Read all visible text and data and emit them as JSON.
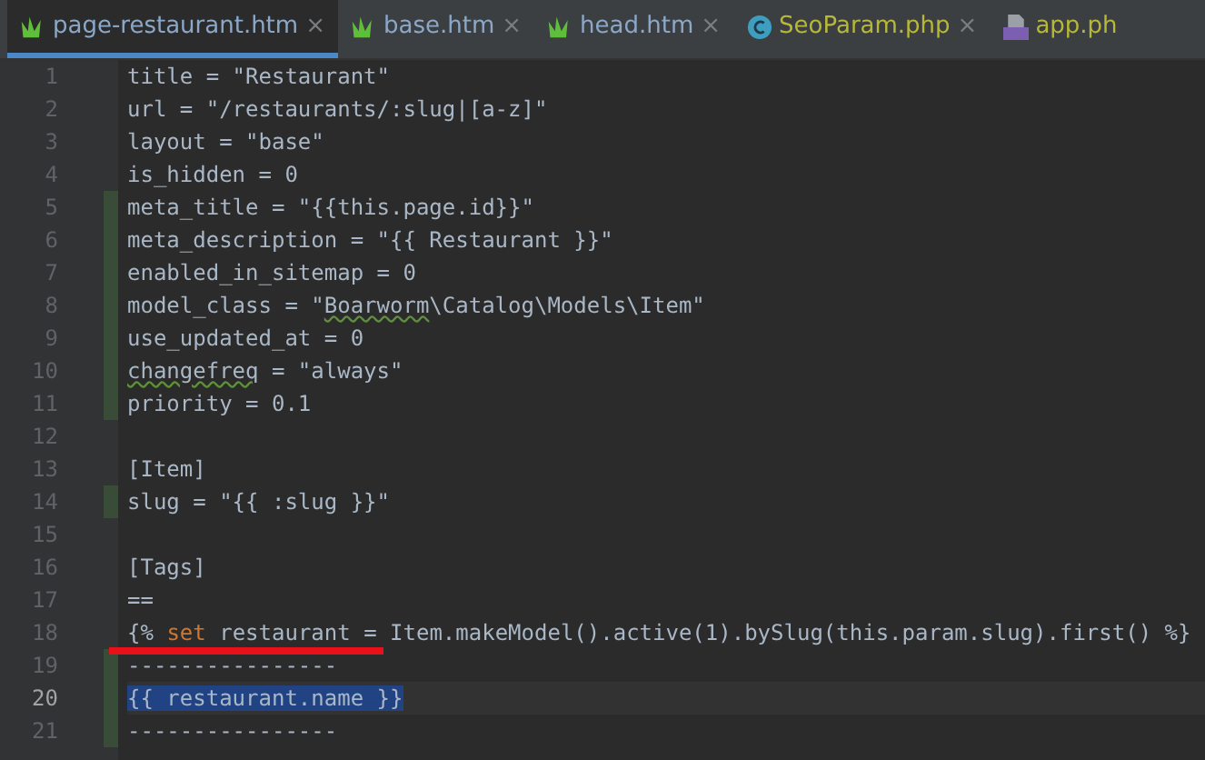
{
  "tabs": [
    {
      "label": "page-restaurant.htm",
      "kind": "htm",
      "color": "#8ca8c8",
      "selected": true,
      "close": "×"
    },
    {
      "label": "base.htm",
      "kind": "htm",
      "color": "#8ca8c8",
      "selected": false,
      "close": "×"
    },
    {
      "label": "head.htm",
      "kind": "htm",
      "color": "#8ca8c8",
      "selected": false,
      "close": "×"
    },
    {
      "label": "SeoParam.php",
      "kind": "class",
      "color": "#b8b838",
      "selected": false,
      "close": "×"
    },
    {
      "label": "app.ph",
      "kind": "php",
      "color": "#b8b838",
      "selected": false
    }
  ],
  "editor": {
    "lines": [
      {
        "number": "1",
        "changed": false,
        "current": false,
        "segments": [
          {
            "text": "title = \"Restaurant\"",
            "kind": "plain"
          }
        ]
      },
      {
        "number": "2",
        "changed": false,
        "current": false,
        "segments": [
          {
            "text": "url = \"/restaurants/:slug|[a-z]\"",
            "kind": "plain"
          }
        ]
      },
      {
        "number": "3",
        "changed": false,
        "current": false,
        "segments": [
          {
            "text": "layout = \"base\"",
            "kind": "plain"
          }
        ]
      },
      {
        "number": "4",
        "changed": false,
        "current": false,
        "segments": [
          {
            "text": "is_hidden = 0",
            "kind": "plain"
          }
        ]
      },
      {
        "number": "5",
        "changed": true,
        "current": false,
        "segments": [
          {
            "text": "meta_title = \"{{this.page.id}}\"",
            "kind": "plain"
          }
        ]
      },
      {
        "number": "6",
        "changed": true,
        "current": false,
        "segments": [
          {
            "text": "meta_description = \"{{ Restaurant }}\"",
            "kind": "plain"
          }
        ]
      },
      {
        "number": "7",
        "changed": true,
        "current": false,
        "segments": [
          {
            "text": "enabled_in_sitemap = 0",
            "kind": "plain"
          }
        ]
      },
      {
        "number": "8",
        "changed": true,
        "current": false,
        "segments": [
          {
            "text": "model_class = \"",
            "kind": "plain"
          },
          {
            "text": "Boarworm",
            "kind": "typo"
          },
          {
            "text": "\\Catalog\\Models\\Item\"",
            "kind": "plain"
          }
        ]
      },
      {
        "number": "9",
        "changed": true,
        "current": false,
        "segments": [
          {
            "text": "use_updated_at = 0",
            "kind": "plain"
          }
        ]
      },
      {
        "number": "10",
        "changed": true,
        "current": false,
        "segments": [
          {
            "text": "changefreq",
            "kind": "typo"
          },
          {
            "text": " = \"always\"",
            "kind": "plain"
          }
        ]
      },
      {
        "number": "11",
        "changed": true,
        "current": false,
        "segments": [
          {
            "text": "priority = 0.1",
            "kind": "plain"
          }
        ]
      },
      {
        "number": "12",
        "changed": false,
        "current": false
      },
      {
        "number": "13",
        "changed": false,
        "current": false,
        "segments": [
          {
            "text": "[Item]",
            "kind": "plain"
          }
        ]
      },
      {
        "number": "14",
        "changed": true,
        "current": false,
        "segments": [
          {
            "text": "slug = \"{{ :slug }}\"",
            "kind": "plain"
          }
        ]
      },
      {
        "number": "15",
        "changed": false,
        "current": false
      },
      {
        "number": "16",
        "changed": false,
        "current": false,
        "segments": [
          {
            "text": "[Tags]",
            "kind": "plain"
          }
        ]
      },
      {
        "number": "17",
        "changed": false,
        "current": false,
        "segments": [
          {
            "text": "==",
            "kind": "plain"
          }
        ]
      },
      {
        "number": "18",
        "changed": false,
        "current": false,
        "underlined": true,
        "segments": [
          {
            "text": "{% ",
            "kind": "plain"
          },
          {
            "text": "set",
            "kind": "keyword"
          },
          {
            "text": " restaurant = Item.makeModel().active(1).bySlug(this.param.slug).first() %}",
            "kind": "plain"
          }
        ]
      },
      {
        "number": "19",
        "changed": true,
        "current": false,
        "segments": [
          {
            "text": "----------------",
            "kind": "plain"
          }
        ]
      },
      {
        "number": "20",
        "changed": true,
        "current": true,
        "segments": [
          {
            "text": "{{ restaurant.name }}",
            "kind": "selected"
          }
        ]
      },
      {
        "number": "21",
        "changed": true,
        "current": false,
        "segments": [
          {
            "text": "----------------",
            "kind": "plain"
          }
        ]
      }
    ]
  }
}
